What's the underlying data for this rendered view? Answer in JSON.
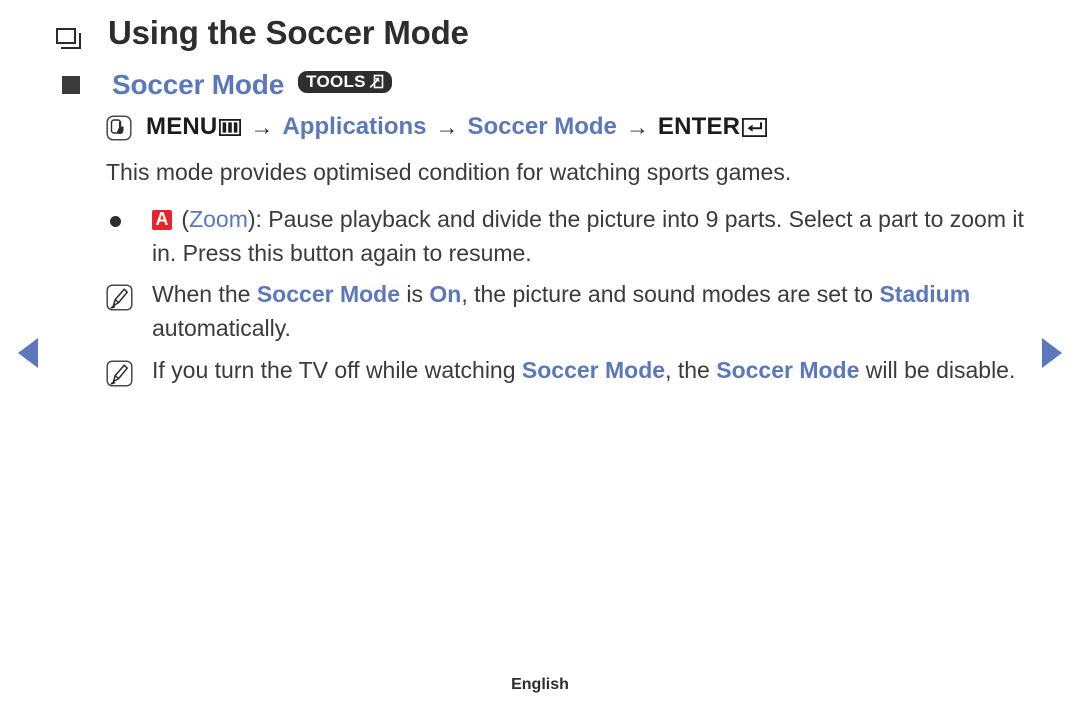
{
  "page": {
    "heading": "Using the Soccer Mode",
    "subheading": "Soccer Mode",
    "tools_badge_label": "TOOLS",
    "footer_label": "English",
    "accent_blue": "#5b78bd",
    "text_color": "#3b3b3b",
    "red_button_color": "#e8242a"
  },
  "nav": {
    "prev_label": "Previous page",
    "next_label": "Next page"
  },
  "menu_path": {
    "icon_name": "oo-press-icon",
    "menu_label": "MENU",
    "menu_glyph_name": "keypad-icon",
    "separator": "→",
    "step_applications": "Applications",
    "step_soccer_mode": "Soccer Mode",
    "enter_label": "ENTER",
    "enter_glyph_name": "enter-return-icon"
  },
  "body": {
    "intro": "This mode provides optimised condition for watching sports games.",
    "items": [
      {
        "marker": "bullet",
        "button_label": "A",
        "parts": [
          {
            "text": " (",
            "style": "dark"
          },
          {
            "text": "Zoom",
            "style": "blue"
          },
          {
            "text": "): Pause playback and divide the picture into 9 parts. Select a part to zoom it in. Press this button again to resume.",
            "style": "dark"
          }
        ]
      },
      {
        "marker": "note",
        "parts": [
          {
            "text": "When the ",
            "style": "dark"
          },
          {
            "text": "Soccer Mode",
            "style": "blue-bold"
          },
          {
            "text": " is ",
            "style": "dark"
          },
          {
            "text": "On",
            "style": "blue-bold"
          },
          {
            "text": ", the picture and sound modes are set to ",
            "style": "dark"
          },
          {
            "text": "Stadium",
            "style": "blue-bold"
          },
          {
            "text": " automatically.",
            "style": "dark"
          }
        ]
      },
      {
        "marker": "note",
        "parts": [
          {
            "text": "If you turn the TV off while watching ",
            "style": "dark"
          },
          {
            "text": "Soccer Mode",
            "style": "blue-bold"
          },
          {
            "text": ", the ",
            "style": "dark"
          },
          {
            "text": "Soccer Mode",
            "style": "blue-bold"
          },
          {
            "text": " will be disable.",
            "style": "dark"
          }
        ]
      }
    ]
  }
}
